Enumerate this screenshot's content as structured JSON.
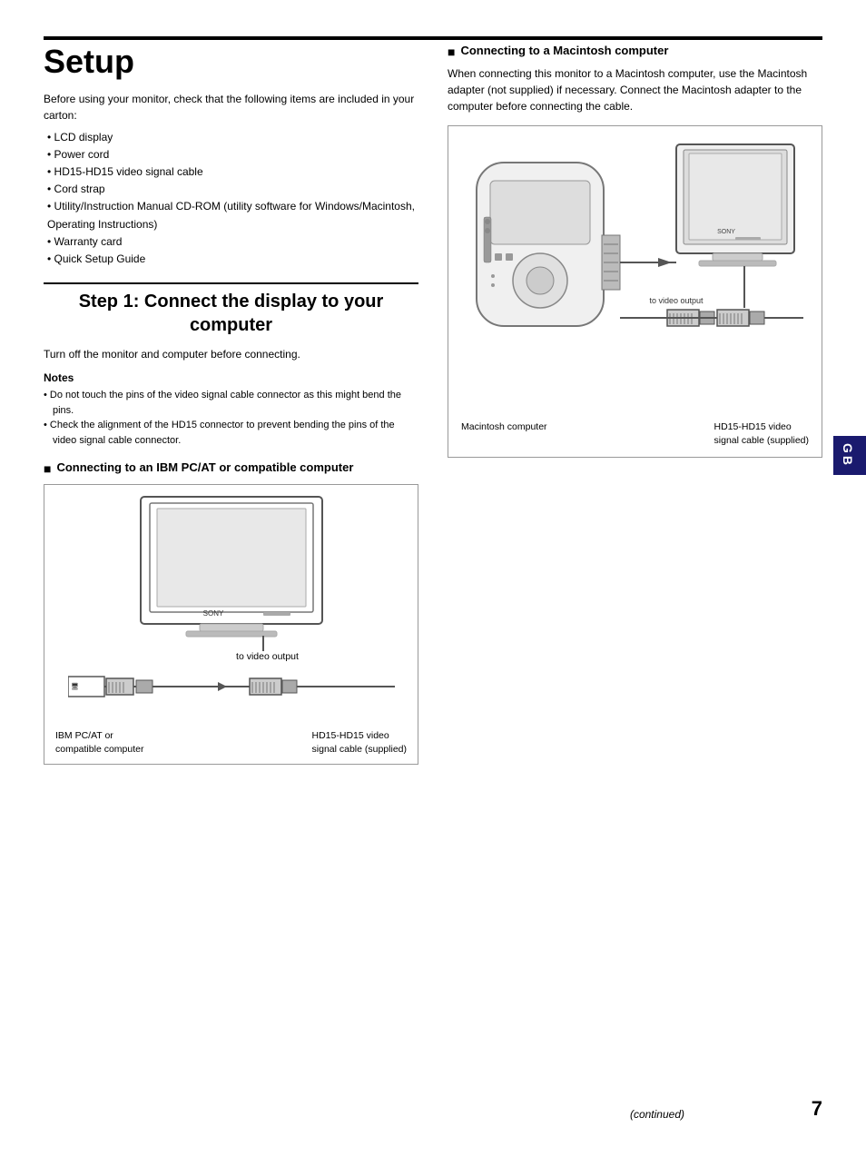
{
  "page": {
    "title": "Setup",
    "topRule": true
  },
  "intro": {
    "text": "Before using your monitor, check that the following items are included in your carton:"
  },
  "bulletItems": [
    "LCD display",
    "Power cord",
    "HD15-HD15 video signal cable",
    "Cord strap",
    "Utility/Instruction Manual CD-ROM (utility software for Windows/Macintosh, Operating Instructions)",
    "Warranty card",
    "Quick Setup Guide"
  ],
  "step1": {
    "title": "Step 1: Connect the display to your computer",
    "desc": "Turn off the monitor and computer before connecting.",
    "notesHeading": "Notes",
    "notes": [
      "Do not touch the pins of the video signal cable connector as this might bend the pins.",
      "Check the alignment of the HD15 connector to prevent bending the pins of the video signal cable connector."
    ]
  },
  "ibmSection": {
    "heading": "Connecting to an IBM PC/AT or compatible computer",
    "toVideoLabel": "to video output",
    "ibmLabel": "IBM PC/AT or\ncompatible computer",
    "cableLabel": "HD15-HD15 video\nsignal cable (supplied)"
  },
  "macSection": {
    "heading": "Connecting to a Macintosh computer",
    "introText": "When connecting this monitor to a Macintosh computer, use the Macintosh adapter (not supplied) if necessary. Connect the Macintosh adapter to the computer before connecting the cable.",
    "toVideoLabel": "to video output",
    "macLabel": "Macintosh computer",
    "cableLabel": "HD15-HD15 video\nsignal cable (supplied)"
  },
  "badge": {
    "text": "GB"
  },
  "footer": {
    "continued": "(continued)",
    "pageNumber": "7"
  }
}
